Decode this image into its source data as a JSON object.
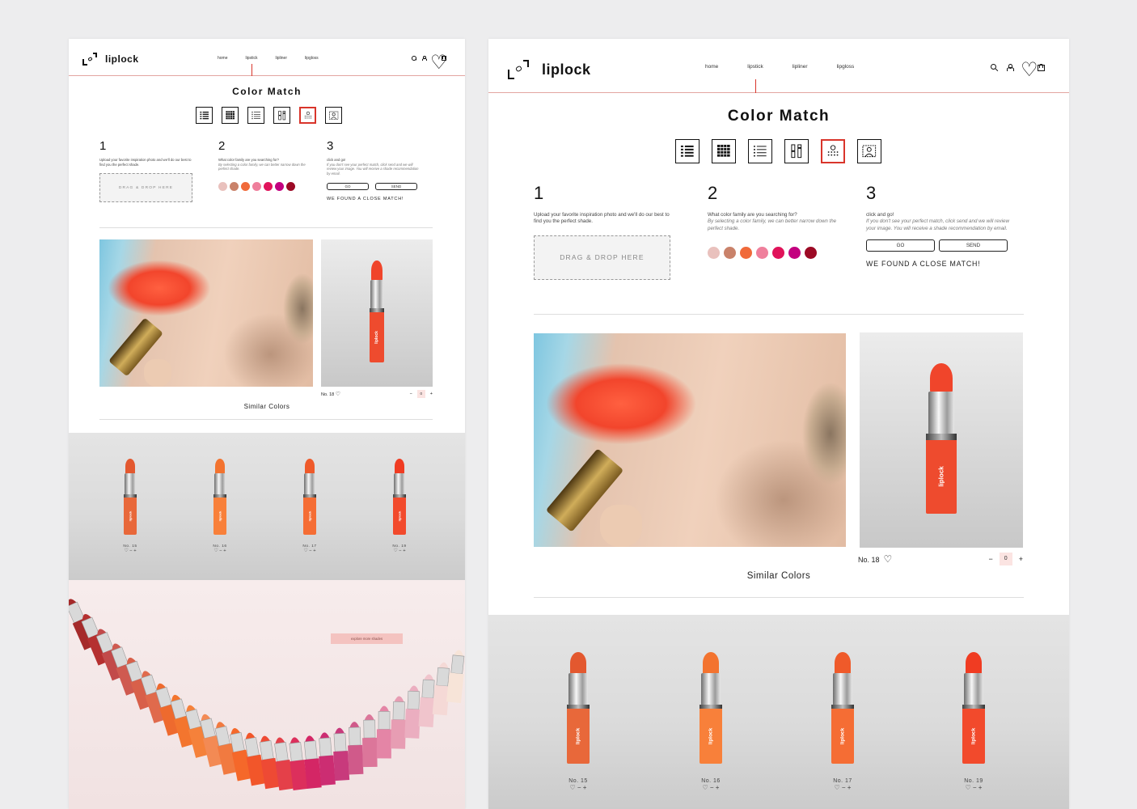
{
  "brand": {
    "name": "liplock",
    "accent": "#d9352b",
    "pink": "#f4c3c0"
  },
  "nav": [
    "home",
    "lipstick",
    "lipliner",
    "lipgloss"
  ],
  "header_icons": [
    "search-icon",
    "user-icon",
    "heart-icon",
    "bag-icon"
  ],
  "color_match": {
    "title": "Color Match",
    "filter_icons": [
      "list-view-icon",
      "grid-view-icon",
      "dotted-list-icon",
      "compare-columns-icon",
      "color-picker-icon",
      "photo-upload-icon"
    ],
    "selected_filter": 4
  },
  "steps": {
    "step1": {
      "number": "1",
      "text": "Upload your favorite inspiration photo and we'll do our best to find you the perfect shade.",
      "dropzone": "DRAG & DROP HERE"
    },
    "step2": {
      "number": "2",
      "text": "What color family are you searching for?",
      "sub": "By selecting a color family, we can better narrow down the perfect shade."
    },
    "step3": {
      "number": "3",
      "text": "click and go!",
      "sub": "If you don't see your perfect match, click send and we will review your image. You will receive a shade recommendation by email.",
      "go_label": "GO",
      "send_label": "SEND",
      "result": "WE FOUND A CLOSE MATCH!"
    }
  },
  "swatch_colors": [
    "#e9c1bd",
    "#c9826a",
    "#f06a3a",
    "#ef7f9c",
    "#e0135a",
    "#c3007f",
    "#9c0a25"
  ],
  "product": {
    "number": "No. 18",
    "quantity": "0",
    "minus": "−",
    "plus": "+",
    "heart": "♡",
    "wordmark": "liplock",
    "colors": {
      "bullet": "#f0452b",
      "tube": "#ee4b2e"
    }
  },
  "similar_colors_title": "Similar Colors",
  "shades": [
    {
      "label": "No. 15",
      "actions": "♡ − +",
      "bullet": "#e3582f",
      "tube": "#e8683a"
    },
    {
      "label": "No. 16",
      "actions": "♡ − +",
      "bullet": "#f3732f",
      "tube": "#f8803a"
    },
    {
      "label": "No. 17",
      "actions": "♡ − +",
      "bullet": "#ef5a2a",
      "tube": "#f56d34"
    },
    {
      "label": "No. 19",
      "actions": "♡ − +",
      "bullet": "#f03c22",
      "tube": "#f24a2c"
    }
  ],
  "banner": {
    "cta": "explore more shades",
    "fan_colors": [
      "#a52a2a",
      "#b53030",
      "#c24a4a",
      "#cf5a50",
      "#d8604a",
      "#e06a4c",
      "#ee6a2e",
      "#f3752e",
      "#f5813a",
      "#f38a54",
      "#f17a40",
      "#f5682a",
      "#f2562a",
      "#ee4a34",
      "#e44049",
      "#dc2f5c",
      "#d42665",
      "#cc2d72",
      "#c83a7c",
      "#d05a8a",
      "#dc769a",
      "#e485a6",
      "#e79db3",
      "#ebaec0",
      "#f0c4cc",
      "#f5d9d6",
      "#f7e4d8"
    ]
  }
}
